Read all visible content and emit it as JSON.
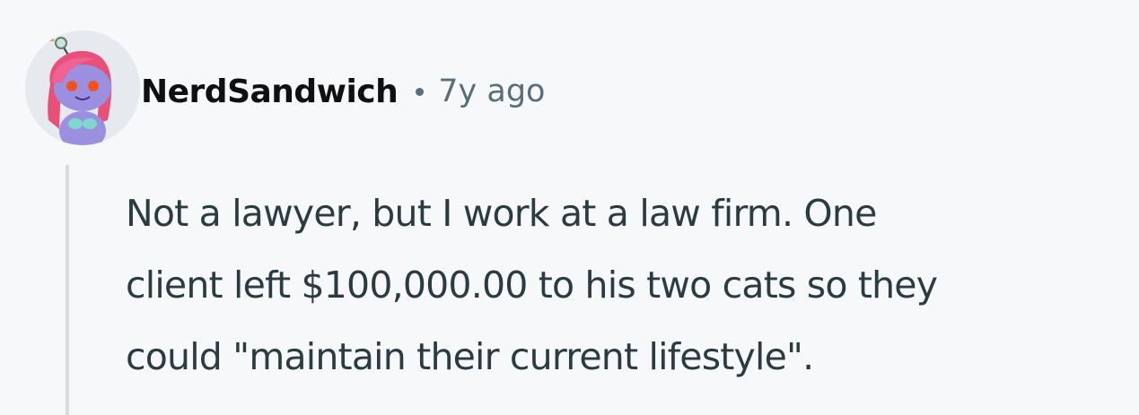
{
  "comment": {
    "author": "NerdSandwich",
    "separator": "•",
    "age": "7y ago",
    "body_lines": [
      "Not a lawyer, but I work at a law firm. One",
      "client left $100,000.00 to his two cats so they",
      "could \"maintain their current lifestyle\"."
    ],
    "avatar_icon": "snoo-avatar-icon"
  },
  "colors": {
    "background": "#f7f8fa",
    "username": "#0e1113",
    "meta": "#576f76",
    "body_text": "#2a3c42",
    "thread_line": "#d7dde2"
  }
}
